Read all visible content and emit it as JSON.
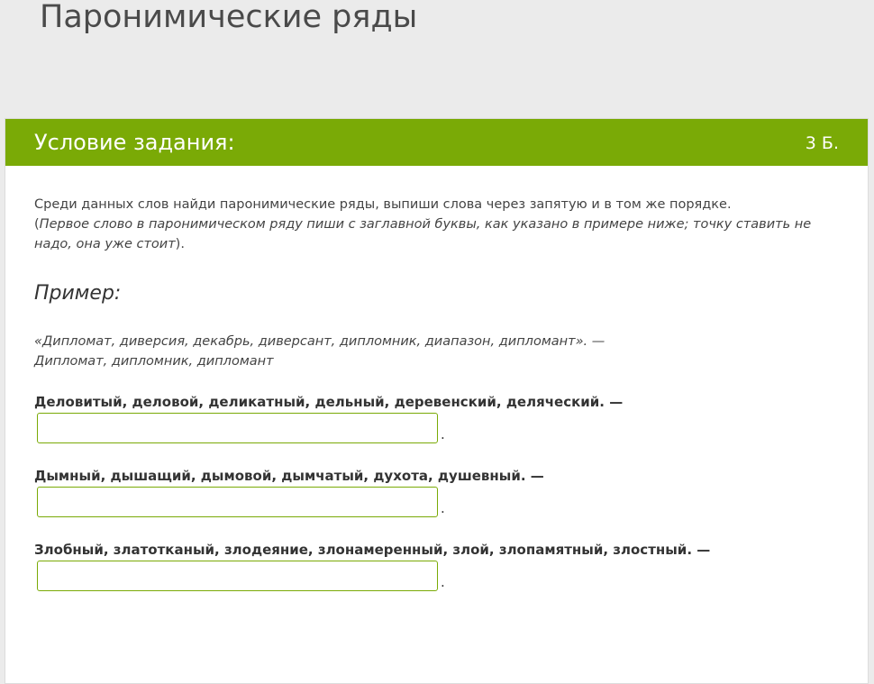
{
  "page": {
    "title": "Паронимические ряды"
  },
  "task": {
    "header_title": "Условие задания:",
    "score": "3 Б.",
    "instruction": "Среди данных слов найди паронимические ряды, выпиши слова через запятую и в том же порядке.",
    "note_open": "(",
    "note_italic": "Первое слово в паронимическом ряду пиши с заглавной буквы, как указано в примере ниже; точку ставить не надо, она уже стоит",
    "note_close": ").",
    "example_heading": "Пример:",
    "example_source": "«Дипломат, диверсия, декабрь, диверсант, дипломник, диапазон, дипломант». —",
    "example_answer": "Дипломат, дипломник, дипломант"
  },
  "questions": [
    {
      "text": "Деловитый, деловой, деликатный, дельный, деревенский, деляческий. —",
      "value": "",
      "suffix": "."
    },
    {
      "text": "Дымный, дышащий, дымовой, дымчатый, духота, душевный. —",
      "value": "",
      "suffix": "."
    },
    {
      "text": "Злобный, златотканый, злодеяние, злонамеренный, злой, злопамятный, злостный. —",
      "value": "",
      "suffix": "."
    }
  ],
  "colors": {
    "accent": "#7aaa06",
    "background": "#ebebeb"
  }
}
